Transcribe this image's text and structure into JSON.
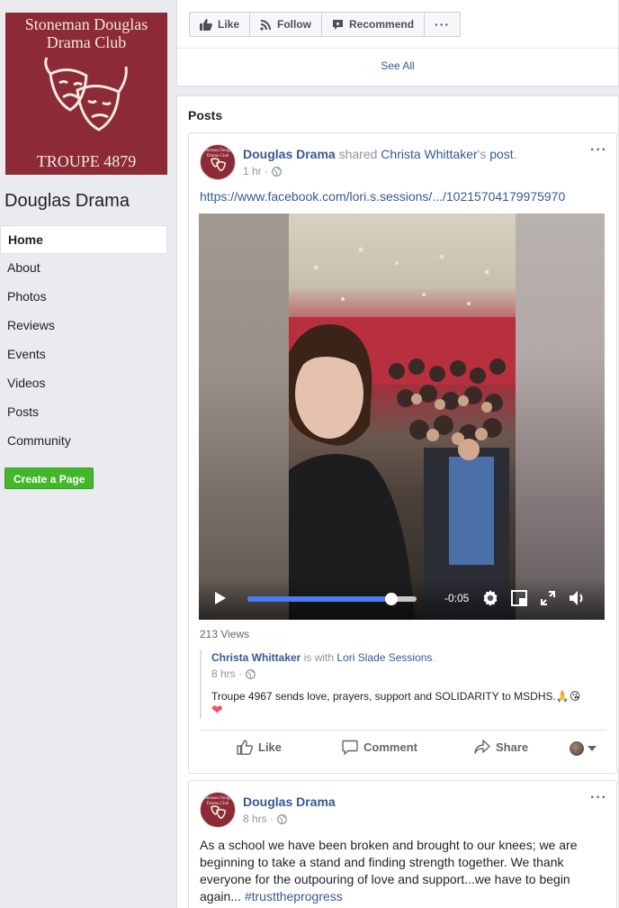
{
  "page": {
    "profile_line1": "Stoneman Douglas",
    "profile_line2": "Drama Club",
    "profile_troupe": "TROUPE 4879",
    "name": "Douglas Drama",
    "create_page_label": "Create a Page"
  },
  "nav": {
    "items": [
      {
        "label": "Home",
        "active": true
      },
      {
        "label": "About"
      },
      {
        "label": "Photos"
      },
      {
        "label": "Reviews"
      },
      {
        "label": "Events"
      },
      {
        "label": "Videos"
      },
      {
        "label": "Posts"
      },
      {
        "label": "Community"
      }
    ]
  },
  "actions": {
    "like": "Like",
    "follow": "Follow",
    "recommend": "Recommend",
    "more": "···",
    "see_all": "See All"
  },
  "posts_heading": "Posts",
  "post1": {
    "author": "Douglas Drama",
    "verb": " shared ",
    "sharer": "Christa Whittaker",
    "possessive": "'s ",
    "object": "post",
    "period": ".",
    "time": "1 hr · ",
    "link": "https://www.facebook.com/lori.s.sessions/.../10215704179975970",
    "video": {
      "time_left": "-0:05",
      "progress": 0.85
    },
    "views": "213 Views",
    "shared": {
      "author": "Christa Whittaker",
      "with": " is with ",
      "tagged": "Lori Slade Sessions",
      "period": ".",
      "time": "8 hrs · ",
      "text": "Troupe 4967 sends love, prayers, support and SOLIDARITY to MSDHS.",
      "emoji1": "🙏",
      "emoji2": "😘",
      "emoji3": "❤"
    },
    "buttons": {
      "like": "Like",
      "comment": "Comment",
      "share": "Share"
    }
  },
  "post2": {
    "author": "Douglas Drama",
    "time": "8 hrs · ",
    "text": "As a school we have been broken and brought to our knees; we are beginning to take a stand and finding strength together. We thank everyone for the outpouring of love and support...we have to begin again... ",
    "hashtag": "#trusttheprogress"
  },
  "colors": {
    "brand_maroon": "#8c2b35",
    "link_blue": "#365899",
    "create_green": "#42b72a",
    "progress_blue": "#4a7cf3"
  }
}
